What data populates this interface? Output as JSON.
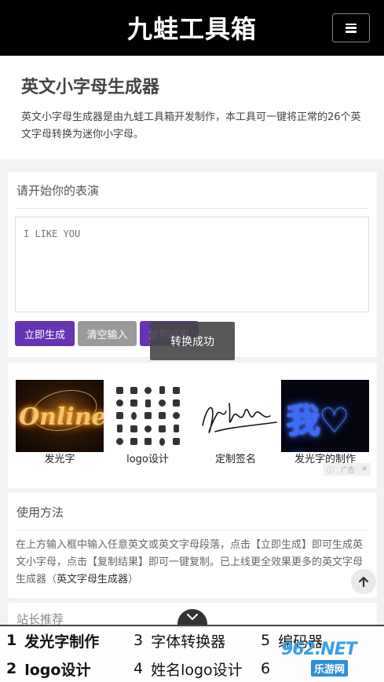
{
  "header": {
    "site_title": "九蛙工具箱"
  },
  "intro": {
    "title": "英文小字母生成器",
    "description": "英文小字母生成器是由九蛙工具箱开发制作，本工具可一键将正常的26个英文字母转换为迷你小字母。"
  },
  "input_panel": {
    "title": "请开始你的表演",
    "input_value": "I LIKE YOU",
    "generate_label": "立即生成",
    "clear_label": "清空输入",
    "copy_label": "复制结果"
  },
  "toast": {
    "message": "转换成功"
  },
  "ads": {
    "items": [
      {
        "label": "发光字",
        "thumb_text": "Online"
      },
      {
        "label": "logo设计"
      },
      {
        "label": "定制签名"
      },
      {
        "label": "发光字的制作",
        "thumb_text": "我♡你"
      }
    ],
    "ad_tag": "广告"
  },
  "usage": {
    "title": "使用方法",
    "text": "在上方输入框中输入任意英文或英文字母段落，点击【立即生成】即可生成英文小字母，点击【复制结果】即可一键复制。已上线更全效果更多的英文字母生成器（",
    "link": "英文字母生成器",
    "text_end": "）"
  },
  "recommend": {
    "title": "站长推荐"
  },
  "bottom_bar": {
    "items": [
      {
        "num": "1",
        "label": "发光字制作"
      },
      {
        "num": "2",
        "label": "logo设计"
      },
      {
        "num": "3",
        "label": "字体转换器"
      },
      {
        "num": "4",
        "label": "姓名logo设计"
      },
      {
        "num": "5",
        "label": "编码器"
      },
      {
        "num": "6",
        "label": ""
      }
    ]
  },
  "watermark": {
    "top": "962.NET",
    "bottom": "乐游网"
  },
  "colors": {
    "accent": "#6633b3",
    "header_bg": "#000000",
    "clear_btn": "#9a9a9a"
  }
}
